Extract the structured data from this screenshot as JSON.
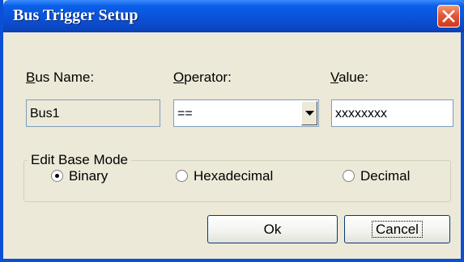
{
  "window": {
    "title": "Bus Trigger Setup"
  },
  "bus_name": {
    "label_prefix": "",
    "label_accel": "B",
    "label_rest": "us Name:",
    "value": "Bus1"
  },
  "operator": {
    "label_accel": "O",
    "label_rest": "perator:",
    "value": "=="
  },
  "value": {
    "label_accel": "V",
    "label_rest": "alue:",
    "value": "xxxxxxxx"
  },
  "edit_base_mode": {
    "legend": "Edit Base Mode",
    "options": [
      {
        "accel": "B",
        "rest": "inary",
        "checked": true
      },
      {
        "accel": "H",
        "rest": "exadecimal",
        "checked": false
      },
      {
        "accel": "D",
        "rest": "ecimal",
        "checked": false
      }
    ]
  },
  "buttons": {
    "ok": "Ok",
    "cancel": "Cancel"
  },
  "colors": {
    "titlebar": "#0a52d8",
    "close": "#e2593a",
    "dialog_bg": "#ece9d8"
  },
  "icons": {
    "close": "close-icon",
    "dropdown": "chevron-down-icon"
  }
}
